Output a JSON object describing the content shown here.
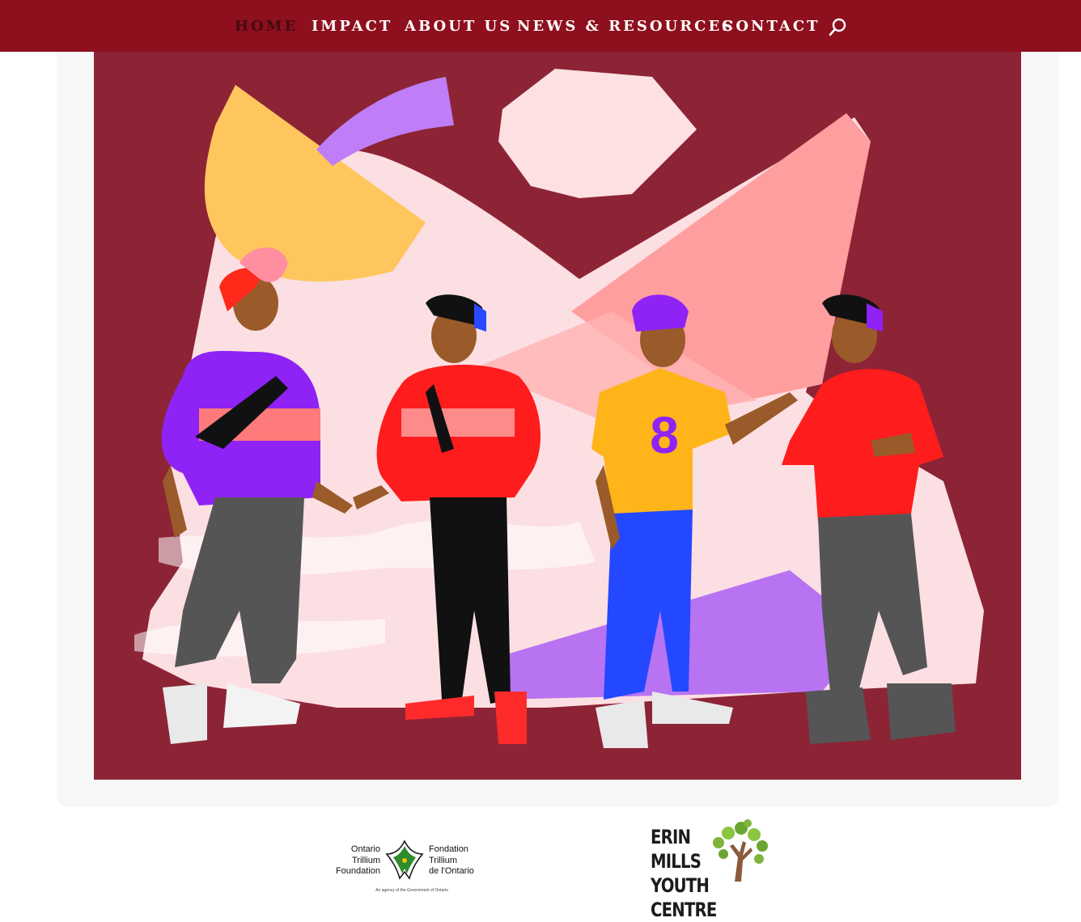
{
  "nav": {
    "items": [
      {
        "label": "HOME",
        "active": true
      },
      {
        "label": "IMPACT"
      },
      {
        "label": "ABOUT US"
      },
      {
        "label": "NEWS & RESOURCES"
      },
      {
        "label": "CONTACT"
      }
    ],
    "search_icon": "search-icon",
    "background_color": "#8e0f1d"
  },
  "hero": {
    "background_color": "#8c2436"
  },
  "footer_logos": {
    "otf": {
      "left_text": "Ontario\nTrillium\nFoundation",
      "right_text": "Fondation\nTrillium\nde l'Ontario",
      "tagline": "An agency of the Government of Ontario"
    },
    "emyc": {
      "text": "ERIN\nMILLS\nYOUTH CENTRE"
    }
  }
}
